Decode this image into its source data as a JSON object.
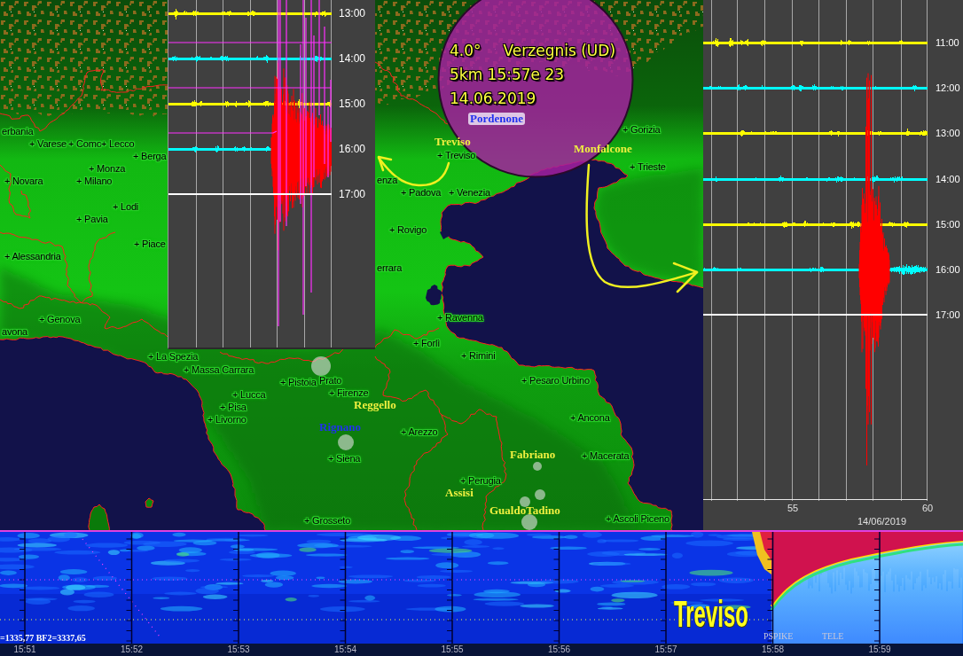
{
  "map": {
    "cities": [
      "erbania",
      "+ Varese",
      "+ Como",
      "+ Lecco",
      "+ Berga",
      "+ Monza",
      "+ Novara",
      "+ Milano",
      "+ Lodi",
      "+ Pavia",
      "+ Piace",
      "+ Alessandria",
      "+ Genova",
      "avona",
      "+ La Spezia",
      "+ Massa Carrara",
      "+ Pistoia",
      "Prato",
      "+ Firenze",
      "+ Lucca",
      "+ Pisa",
      "+ Livorno",
      "+ Siena",
      "+ Grosseto",
      "+ Treviso",
      "enza",
      "+ Padova",
      "+ Venezia",
      "+ Rovigo",
      "+ Gorizia",
      "+ Trieste",
      "errara",
      "+ Ravenna",
      "+ Forlì",
      "+ Rimini",
      "+ Pesaro Urbino",
      "+ Arezzo",
      "+ Ancona",
      "+ Macerata",
      "+ Perugia",
      "+ Ascoli Piceno"
    ],
    "stations": [
      {
        "name": "Treviso",
        "color": "#f0f040"
      },
      {
        "name": "Monfalcone",
        "color": "#f0f040"
      },
      {
        "name": "Pordenone",
        "color": "#2030f0"
      },
      {
        "name": "Reggello",
        "color": "#f0f040"
      },
      {
        "name": "Rignano",
        "color": "#2030f0"
      },
      {
        "name": "Fabriano",
        "color": "#f0f040"
      },
      {
        "name": "Assisi",
        "color": "#f0f040"
      },
      {
        "name": "GualdoTadino",
        "color": "#f0f040"
      }
    ],
    "event": {
      "magnitude": "4.0°",
      "location": "Verzegnis (UD)",
      "details": "5km 15:57e 23",
      "date": "14.06.2019"
    }
  },
  "left_seismogram": {
    "traces": [
      {
        "label": "13:00",
        "color": "#ffff00",
        "kind": "signal"
      },
      {
        "label": "14:00",
        "color": "#00ffff",
        "kind": "signal"
      },
      {
        "label": "15:00",
        "color": "#ffff00",
        "kind": "signal"
      },
      {
        "label": "16:00",
        "color": "#00ffff",
        "kind": "event"
      },
      {
        "label": "17:00",
        "color": "#ffffff",
        "kind": "empty"
      }
    ]
  },
  "right_seismogram": {
    "traces": [
      {
        "label": "11:00",
        "color": "#ffff00",
        "kind": "signal"
      },
      {
        "label": "12:00",
        "color": "#00ffff",
        "kind": "signal"
      },
      {
        "label": "13:00",
        "color": "#ffff00",
        "kind": "signal"
      },
      {
        "label": "14:00",
        "color": "#00ffff",
        "kind": "signal"
      },
      {
        "label": "15:00",
        "color": "#ffff00",
        "kind": "signal"
      },
      {
        "label": "16:00",
        "color": "#00ffff",
        "kind": "event"
      },
      {
        "label": "17:00",
        "color": "#ffffff",
        "kind": "empty"
      }
    ],
    "x_ticks": [
      "55",
      "60"
    ],
    "date": "14/06/2019"
  },
  "spectrogram": {
    "station": "Treviso",
    "phase_labels": [
      "PSPIKE",
      "TELE"
    ],
    "readout": "=1335,77 BF2=3337,65",
    "time_ticks": [
      "15:51",
      "15:52",
      "15:53",
      "15:54",
      "15:55",
      "15:56",
      "15:57",
      "15:58",
      "15:59"
    ]
  }
}
